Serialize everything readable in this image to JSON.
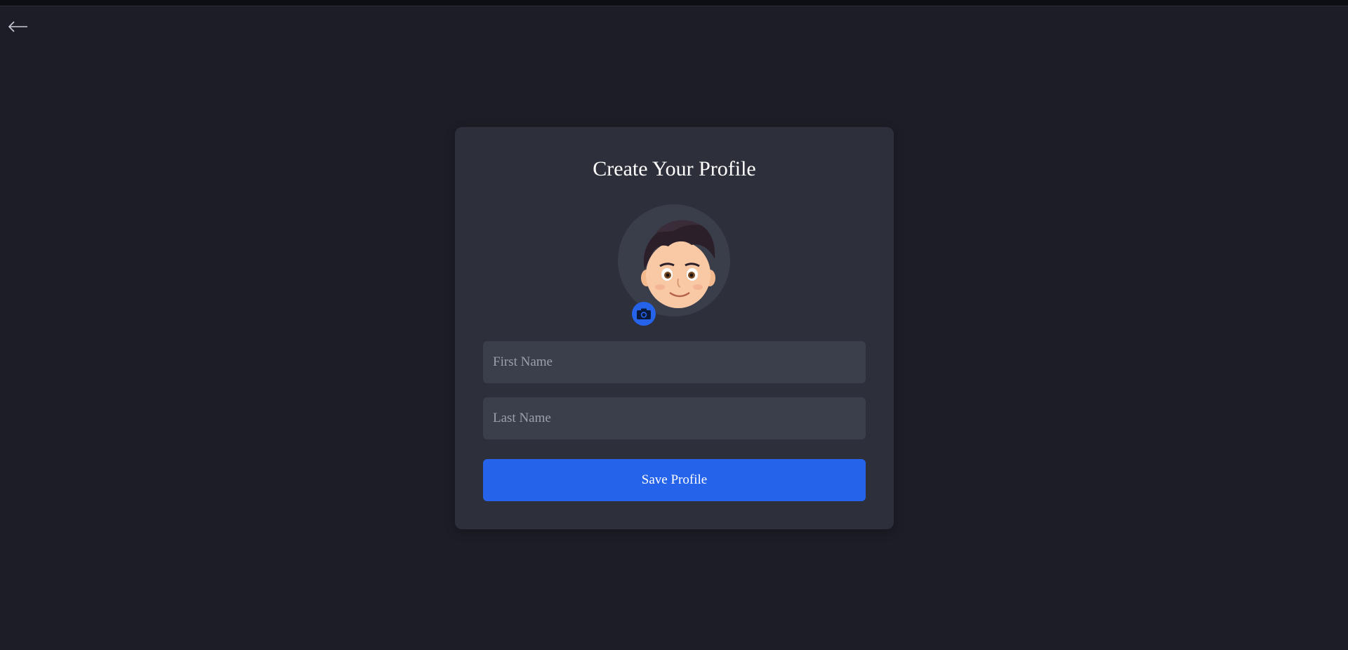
{
  "header": {
    "back_icon": "arrow-left-icon"
  },
  "profile_form": {
    "title": "Create Your Profile",
    "avatar_icon": "cartoon-boy-avatar",
    "camera_icon": "camera-icon",
    "first_name": {
      "value": "",
      "placeholder": "First Name"
    },
    "last_name": {
      "value": "",
      "placeholder": "Last Name"
    },
    "save_label": "Save Profile"
  },
  "colors": {
    "background": "#1c1d26",
    "card": "#2d2f3a",
    "input": "#3b3e4b",
    "accent": "#2563eb"
  }
}
